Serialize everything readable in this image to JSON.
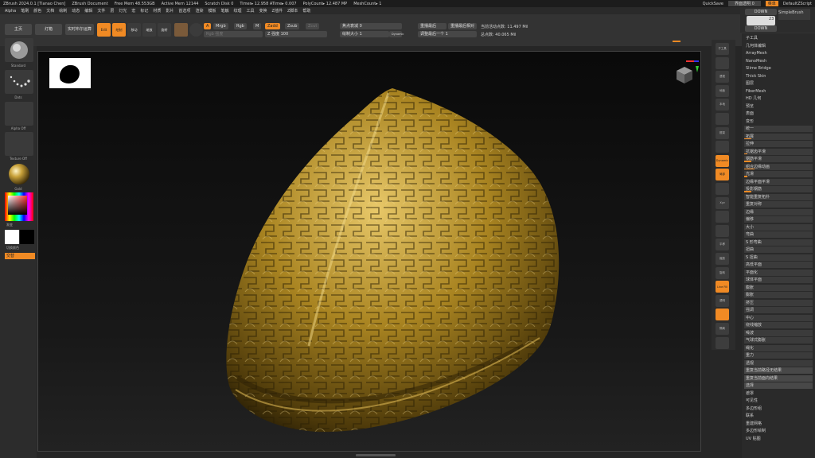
{
  "window": {
    "title": "ZBrush 2024.0.1 [Tianao Chen]",
    "doc": "ZBrush Document",
    "free_mem": "Free Mem 48.553GB",
    "active_mem": "Active Mem 12144",
    "scratch": "Scratch Disk 0",
    "timer": "Timer▸ 12.958 ATime▸ 0.007",
    "polycount": "PolyCount▸ 12.487 MP",
    "meshcount": "MeshCount▸ 1",
    "quicksave": "QuickSave",
    "transparency": "界面透明 0",
    "menus_btn": "菜单",
    "script": "DefaultZScript"
  },
  "menus": [
    "Alpha",
    "笔刷",
    "颜色",
    "文档",
    "绘制",
    "动态",
    "编辑",
    "文件",
    "层",
    "灯光",
    "宏",
    "标记",
    "材质",
    "影片",
    "首选项",
    "渲染",
    "模板",
    "笔触",
    "纹理",
    "工具",
    "变换",
    "Z插件",
    "Z脚本",
    "帮助"
  ],
  "toolbar": {
    "home": "主页",
    "lightbox": "灯箱",
    "live_boolean": "实时布尔运算",
    "edit": "Edit",
    "draw": "绘制",
    "move": "移动",
    "scale": "缩放",
    "rotate": "旋转",
    "a_btn": "A",
    "mrgb": "Mrgb",
    "rgb": "Rgb",
    "m": "M",
    "zadd": "Zadd",
    "zsub": "Zsub",
    "zcut": "Zcut",
    "rgb_intensity": "Rgb 强度",
    "z_intensity": "Z 强度 100",
    "focal_shift": "焦点衰减 0",
    "draw_size": "绘制大小 1",
    "dynamic": "Dynamic",
    "replay_last": "重播最后",
    "replay_rel": "重播最后相对",
    "adjust_last": "调整最后一个 1",
    "active_points": "当前活动点数: 11.497 Mil",
    "total_points": "总点数: 40.065 Mil"
  },
  "left_tray": {
    "brush": "Standard",
    "stroke": "Dots",
    "alpha": "Alpha Off",
    "texture": "Texture Off",
    "material": "Gold",
    "gradient": "渐变",
    "switch_color": "切换颜色",
    "alternate": "交替"
  },
  "right_shelf": [
    "子工具",
    "",
    "透视",
    "地板",
    "本地",
    "",
    "框架",
    "",
    "Dynamic",
    "局部",
    "",
    "Xyz",
    "",
    "",
    "平移",
    "缩放",
    "旋转",
    "Line Fill",
    "透明",
    "",
    "隔离",
    ""
  ],
  "top_right": {
    "down1": "DOWN",
    "down2": "DOWN",
    "brush_count": "23",
    "simple_brush": "SimpleBrush"
  },
  "panel": {
    "items": [
      {
        "label": "子工具",
        "kind": "header"
      },
      {
        "label": "几何体编辑",
        "kind": "header"
      },
      {
        "label": "ArrayMesh",
        "kind": "header"
      },
      {
        "label": "NanoMesh",
        "kind": "header"
      },
      {
        "label": "Slime Bridge",
        "kind": "header"
      },
      {
        "label": "Thick Skin",
        "kind": "header"
      },
      {
        "label": "图层",
        "kind": "header"
      },
      {
        "label": "FiberMesh",
        "kind": "header"
      },
      {
        "label": "HD 几何",
        "kind": "header"
      },
      {
        "label": "预览",
        "kind": "header"
      },
      {
        "label": "表面",
        "kind": "header"
      },
      {
        "label": "变形",
        "kind": "header"
      },
      {
        "label": "统一",
        "kind": "slider",
        "fill": 0.0
      },
      {
        "label": "拓展",
        "kind": "slider",
        "fill": 0.1
      },
      {
        "label": "拉伸",
        "kind": "slider",
        "fill": 0.0
      },
      {
        "label": "抗锯齿平滑",
        "kind": "slider",
        "fill": 0.05
      },
      {
        "label": "钢筋平滑",
        "kind": "slider",
        "fill": 0.1
      },
      {
        "label": "组合边缘动画",
        "kind": "slider",
        "fill": 0.15
      },
      {
        "label": "光滑",
        "kind": "slider",
        "fill": 0.05
      },
      {
        "label": "边缘平面平滑",
        "kind": "slider",
        "fill": 0.0
      },
      {
        "label": "投影钢筋",
        "kind": "slider",
        "fill": 0.1
      },
      {
        "label": "智能重复拓扑",
        "kind": "slider",
        "fill": 0.0
      },
      {
        "label": "重复对称",
        "kind": "slider",
        "fill": 0.0
      },
      {
        "label": "边缘",
        "kind": "slider",
        "fill": 0.0
      },
      {
        "label": "偏移",
        "kind": "slider",
        "fill": 0.0
      },
      {
        "label": "大小",
        "kind": "slider",
        "fill": 0.0
      },
      {
        "label": "弯曲",
        "kind": "slider",
        "fill": 0.0
      },
      {
        "label": "S 形弯曲",
        "kind": "slider",
        "fill": 0.0
      },
      {
        "label": "扭曲",
        "kind": "slider",
        "fill": 0.0
      },
      {
        "label": "S 扭曲",
        "kind": "slider",
        "fill": 0.0
      },
      {
        "label": "高低平面",
        "kind": "slider",
        "fill": 0.0
      },
      {
        "label": "平面化",
        "kind": "slider",
        "fill": 0.0
      },
      {
        "label": "球体平面",
        "kind": "slider",
        "fill": 0.0
      },
      {
        "label": "膨胀",
        "kind": "slider",
        "fill": 0.0
      },
      {
        "label": "膨胀",
        "kind": "slider",
        "fill": 0.0
      },
      {
        "label": "挤压",
        "kind": "slider",
        "fill": 0.0
      },
      {
        "label": "强调",
        "kind": "slider",
        "fill": 0.0
      },
      {
        "label": "中心",
        "kind": "slider",
        "fill": 0.0
      },
      {
        "label": "绕线缩放",
        "kind": "slider",
        "fill": 0.0
      },
      {
        "label": "噪波",
        "kind": "slider",
        "fill": 0.0
      },
      {
        "label": "气球式膨胀",
        "kind": "slider",
        "fill": 0.0
      },
      {
        "label": "绳化",
        "kind": "slider",
        "fill": 0.0
      },
      {
        "label": "重力",
        "kind": "slider",
        "fill": 0.0
      },
      {
        "label": "透视",
        "kind": "slider",
        "fill": 0.0
      },
      {
        "label": "重复当前路径无结果",
        "kind": "button"
      },
      {
        "label": "重复当前面向结果",
        "kind": "button"
      },
      {
        "label": "选择",
        "kind": "button"
      },
      {
        "label": "遮罩",
        "kind": "header"
      },
      {
        "label": "可见性",
        "kind": "header"
      },
      {
        "label": "多边形组",
        "kind": "header"
      },
      {
        "label": "联系",
        "kind": "header"
      },
      {
        "label": "重建网格",
        "kind": "header"
      },
      {
        "label": "多边形绘制",
        "kind": "header"
      },
      {
        "label": "UV 贴图",
        "kind": "header"
      }
    ]
  }
}
